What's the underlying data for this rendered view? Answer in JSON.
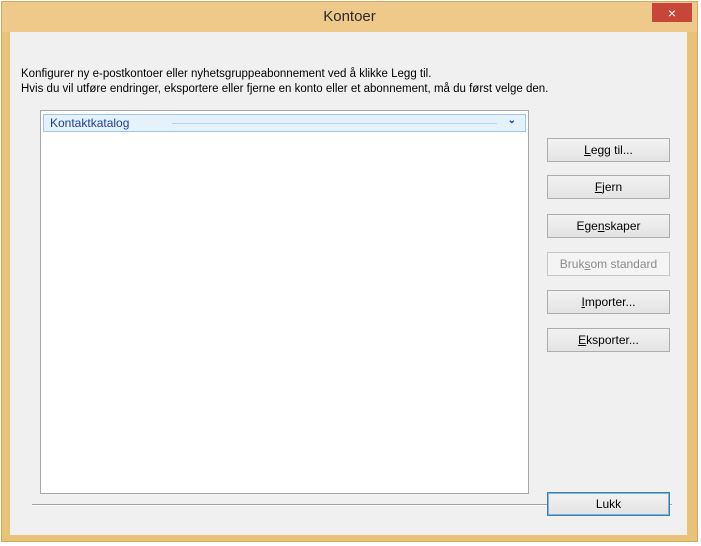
{
  "window": {
    "title": "Kontoer",
    "close_icon": "×"
  },
  "description": {
    "line1": "Konfigurer ny e-postkontoer eller nyhetsgruppeabonnement ved å klikke Legg til.",
    "line2": "Hvis du vil utføre endringer, eksportere eller fjerne en konto eller et abonnement, må du først velge den."
  },
  "account_list": {
    "group_label": "Kontaktkatalog",
    "group_chevron": "⌄"
  },
  "buttons": {
    "add": {
      "pre": "",
      "key": "L",
      "post": "egg til..."
    },
    "remove": {
      "pre": "",
      "key": "F",
      "post": "jern"
    },
    "properties": {
      "pre": "Ege",
      "key": "n",
      "post": "skaper"
    },
    "set_default": {
      "pre": "Bruk ",
      "key": "s",
      "post": "om standard"
    },
    "import": {
      "pre": "",
      "key": "I",
      "post": "mporter..."
    },
    "export": {
      "pre": "",
      "key": "E",
      "post": "ksporter..."
    },
    "close": "Lukk"
  },
  "colors": {
    "title_bar": "#eec98a",
    "close_button": "#c7463a",
    "group_header_text": "#1e3f98"
  }
}
